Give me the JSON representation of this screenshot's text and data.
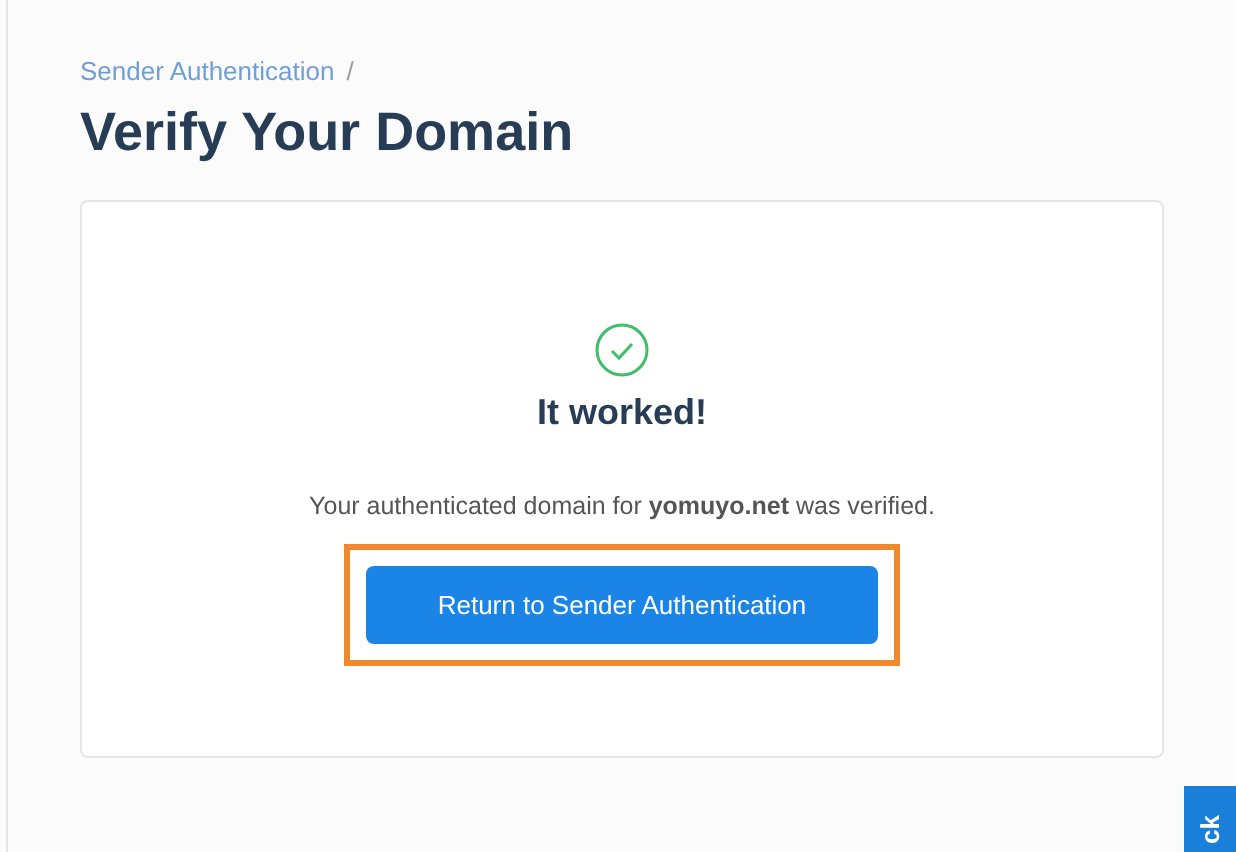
{
  "breadcrumb": {
    "link": "Sender Authentication",
    "separator": "/"
  },
  "title": "Verify Your Domain",
  "card": {
    "heading": "It worked!",
    "message": "Your authenticated domain for **yomuyo.net** was verified.",
    "button": {
      "label": "Return to Sender Authentication",
      "highlighted": true
    }
  },
  "feedback_tab": {
    "label": "ck"
  }
}
